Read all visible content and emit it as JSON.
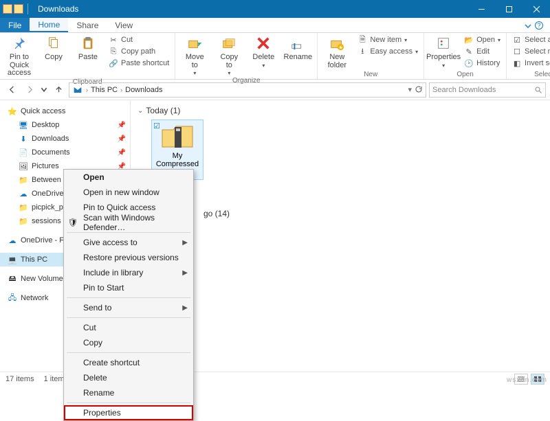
{
  "window": {
    "title": "Downloads"
  },
  "tabs": {
    "file": "File",
    "home": "Home",
    "share": "Share",
    "view": "View"
  },
  "ribbon": {
    "clipboard": {
      "label": "Clipboard",
      "pin": "Pin to Quick\naccess",
      "copy": "Copy",
      "paste": "Paste",
      "cut": "Cut",
      "copy_path": "Copy path",
      "paste_shortcut": "Paste shortcut"
    },
    "organize": {
      "label": "Organize",
      "move_to": "Move\nto",
      "copy_to": "Copy\nto",
      "delete": "Delete",
      "rename": "Rename"
    },
    "new": {
      "label": "New",
      "new_folder": "New\nfolder",
      "new_item": "New item",
      "easy_access": "Easy access"
    },
    "open": {
      "label": "Open",
      "properties": "Properties",
      "open": "Open",
      "edit": "Edit",
      "history": "History"
    },
    "select": {
      "label": "Select",
      "select_all": "Select all",
      "select_none": "Select none",
      "invert": "Invert selection"
    }
  },
  "breadcrumb": {
    "this_pc": "This PC",
    "downloads": "Downloads"
  },
  "search": {
    "placeholder": "Search Downloads"
  },
  "nav": {
    "quick": "Quick access",
    "desktop": "Desktop",
    "downloads": "Downloads",
    "documents": "Documents",
    "pictures": "Pictures",
    "between": "Between PCs",
    "onedrive_fa": "OneDrive - Fa…",
    "picpick": "picpick_portal",
    "sessions": "sessions",
    "onedrive_fam": "OneDrive - Fam…",
    "this_pc": "This PC",
    "new_volume": "New Volume (E…",
    "network": "Network"
  },
  "groups": {
    "today": "Today (1)",
    "long_ago": "go (14)"
  },
  "file": {
    "name": "My Compressed\nFiles"
  },
  "context": {
    "open": "Open",
    "open_new": "Open in new window",
    "pin_quick": "Pin to Quick access",
    "defender": "Scan with Windows Defender…",
    "give_access": "Give access to",
    "restore": "Restore previous versions",
    "include_lib": "Include in library",
    "pin_start": "Pin to Start",
    "send_to": "Send to",
    "cut": "Cut",
    "copy": "Copy",
    "shortcut": "Create shortcut",
    "delete": "Delete",
    "rename": "Rename",
    "properties": "Properties"
  },
  "status": {
    "items": "17 items",
    "selected": "1 item selected"
  },
  "watermark": "wsxdn.com"
}
